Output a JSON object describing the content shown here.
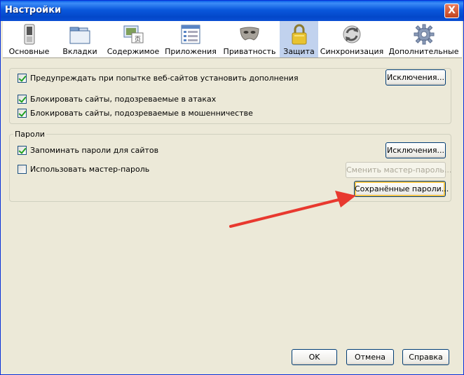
{
  "window": {
    "title": "Настройки",
    "close_label": "X"
  },
  "toolbar": {
    "items": [
      {
        "label": "Основные",
        "icon": "switch-icon"
      },
      {
        "label": "Вкладки",
        "icon": "tabs-icon"
      },
      {
        "label": "Содержимое",
        "icon": "content-icon"
      },
      {
        "label": "Приложения",
        "icon": "applications-icon"
      },
      {
        "label": "Приватность",
        "icon": "mask-icon"
      },
      {
        "label": "Защита",
        "icon": "lock-icon"
      },
      {
        "label": "Синхронизация",
        "icon": "sync-icon"
      },
      {
        "label": "Дополнительные",
        "icon": "gear-icon"
      }
    ],
    "selected": "Защита"
  },
  "security": {
    "warn_addons": {
      "label": "Предупреждать при попытке веб-сайтов установить дополнения",
      "checked": true
    },
    "exceptions_label": "Исключения...",
    "block_attack": {
      "label": "Блокировать сайты, подозреваемые в атаках",
      "checked": true
    },
    "block_forgery": {
      "label": "Блокировать сайты, подозреваемые в мошенничестве",
      "checked": true
    }
  },
  "passwords": {
    "group_title": "Пароли",
    "remember": {
      "label": "Запоминать пароли для сайтов",
      "checked": true
    },
    "exceptions_label": "Исключения...",
    "master": {
      "label": "Использовать мастер-пароль",
      "checked": false
    },
    "change_master_label": "Сменить мастер-пароль...",
    "saved_label": "Сохранённые пароли..."
  },
  "footer": {
    "ok_label": "OK",
    "cancel_label": "Отмена",
    "help_label": "Справка"
  },
  "annotation": {
    "arrow_color": "#E8392F"
  }
}
